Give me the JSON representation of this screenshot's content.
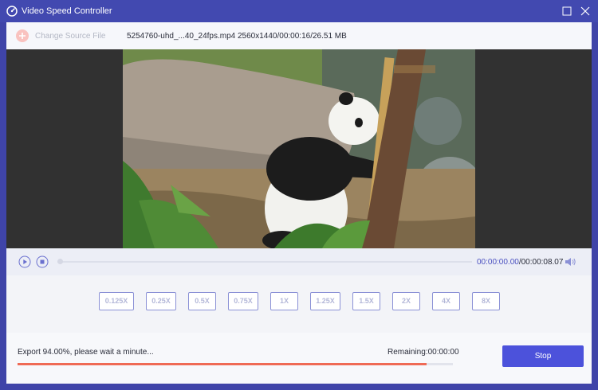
{
  "window": {
    "title": "Video Speed Controller",
    "accent_color": "#4249b0"
  },
  "toolbar": {
    "change_source_label": "Change Source File",
    "file_name": "5254760-uhd_...40_24fps.mp4",
    "file_info": "2560x1440/00:00:16/26.51 MB"
  },
  "player": {
    "current_time": "00:00:00.00",
    "total_time": "/00:00:08.07",
    "icons": [
      "play-icon",
      "stop-icon",
      "volume-icon"
    ]
  },
  "speeds": [
    {
      "label": "0.125X"
    },
    {
      "label": "0.25X"
    },
    {
      "label": "0.5X"
    },
    {
      "label": "0.75X"
    },
    {
      "label": "1X"
    },
    {
      "label": "1.25X"
    },
    {
      "label": "1.5X"
    },
    {
      "label": "2X"
    },
    {
      "label": "4X"
    },
    {
      "label": "8X"
    }
  ],
  "export": {
    "status_text": "Export 94.00%, please wait a minute...",
    "remaining_text": "Remaining:00:00:00",
    "progress_percent": 94,
    "progress_color": "#ef6a55",
    "stop_label": "Stop",
    "stop_color": "#4c52db"
  }
}
